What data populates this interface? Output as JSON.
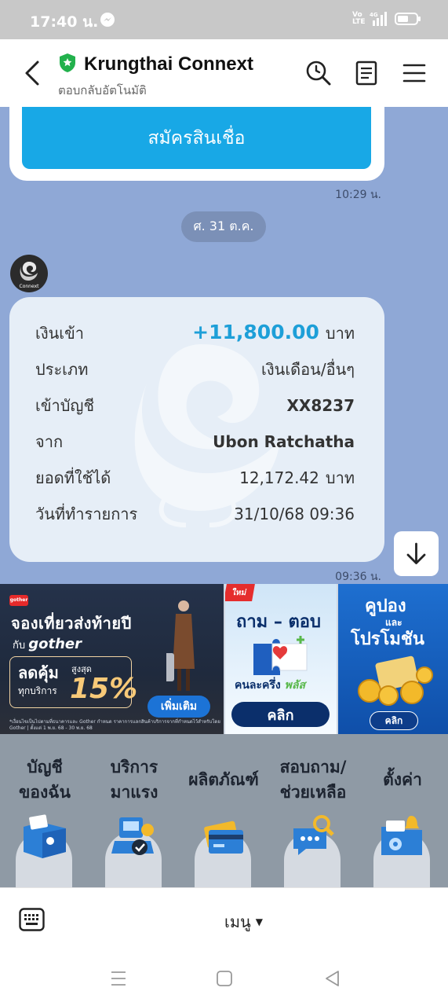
{
  "status_bar": {
    "time": "17:40 น.",
    "volte": "Vo LTE",
    "network": "4G"
  },
  "header": {
    "title": "Krungthai Connext",
    "subtitle": "ตอบกลับอัตโนมัติ"
  },
  "chat": {
    "apply_button": "สมัครสินเชื่อ",
    "time_1": "10:29 น.",
    "date_separator": "ศ. 31 ต.ค.",
    "avatar_label": "Connext",
    "transaction": {
      "rows": [
        {
          "label": "เงินเข้า",
          "value": "+11,800.00",
          "unit": "บาท"
        },
        {
          "label": "ประเภท",
          "value": "เงินเดือน/อื่นๆ"
        },
        {
          "label": "เข้าบัญชี",
          "value": "XX8237"
        },
        {
          "label": "จาก",
          "value": "Ubon Ratchatha"
        },
        {
          "label": "ยอดที่ใช้ได้",
          "value": "12,172.42",
          "unit": "บาท"
        },
        {
          "label": "วันที่ทำรายการ",
          "value": "31/10/68 09:36"
        }
      ]
    },
    "time_2": "09:36 น."
  },
  "banners": {
    "gother": {
      "logo": "gother",
      "title": "จองเที่ยวส่งท้ายปี",
      "with": "กับ",
      "brand": "gother",
      "deal_line1": "ลดคุ้ม",
      "deal_line2": "ทุกบริการ",
      "up_to": "สูงสุด",
      "percent": "15%",
      "more_button": "เพิ่มเติม",
      "fine_print": "*เงื่อนไขเป็นไปตามที่ธนาคารและ Gother กำหนด ราคาการแลกสินค้าบริการจากที่กำหนดไว้สำหรับโดย Gother | ตั้งแต่ 1 พ.ย. 68 - 30 พ.ย. 68"
    },
    "qa": {
      "tag": "ใหม่",
      "title": "ถาม – ตอบ",
      "subtitle_a": "คนละครึ่ง",
      "subtitle_b": "พลัส",
      "button": "คลิก"
    },
    "coupon": {
      "title_1": "คูปอง",
      "and": "และ",
      "title_2": "โปรโมชัน",
      "button": "คลิก"
    }
  },
  "rich_menu": {
    "items": [
      {
        "label_1": "บัญชี",
        "label_2": "ของฉัน"
      },
      {
        "label_1": "บริการ",
        "label_2": "มาแรง"
      },
      {
        "label_1": "ผลิตภัณฑ์",
        "label_2": ""
      },
      {
        "label_1": "สอบถาม/",
        "label_2": "ช่วยเหลือ"
      },
      {
        "label_1": "ตั้งค่า",
        "label_2": ""
      }
    ]
  },
  "keyboard_bar": {
    "menu_label": "เมนู"
  },
  "colors": {
    "chat_bg": "#8fa8d6",
    "accent": "#18a8e6",
    "amount": "#1d9fd8",
    "brand_green": "#22b14c"
  }
}
